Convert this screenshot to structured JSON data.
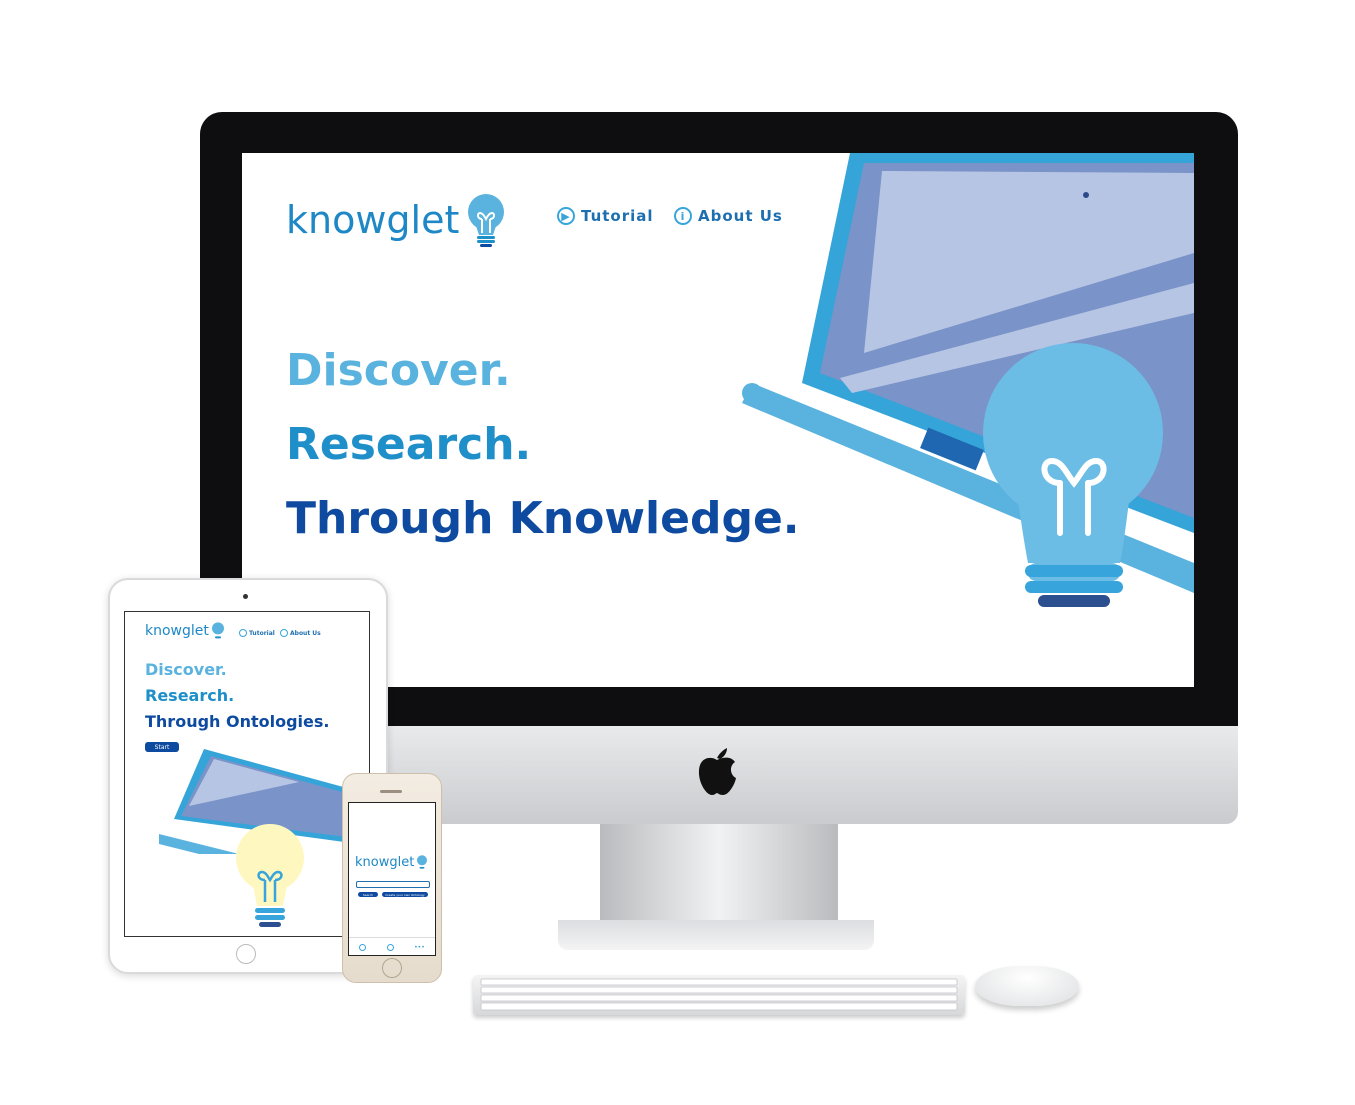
{
  "desktop": {
    "logo": "knowglet",
    "nav": [
      {
        "label": "Tutorial",
        "icon": "video-camera-icon"
      },
      {
        "label": "About Us",
        "icon": "info-icon"
      }
    ],
    "hero": [
      "Discover.",
      "Research.",
      "Through Knowledge."
    ]
  },
  "tablet": {
    "logo": "knowglet",
    "nav": [
      {
        "label": "Tutorial",
        "icon": "video-camera-icon"
      },
      {
        "label": "About Us",
        "icon": "info-icon"
      }
    ],
    "hero": [
      "Discover.",
      "Research.",
      "Through Ontologies."
    ],
    "start_label": "Start"
  },
  "phone": {
    "logo": "knowglet",
    "search_label": "Search",
    "create_label": "Create your own Ontology"
  },
  "colors": {
    "brand_light": "#5ab3de",
    "brand_mid": "#1e8fc9",
    "brand_dark": "#0d4aa0",
    "bulb": "#6cbde5",
    "laptop_screen": "#7a93c8"
  }
}
